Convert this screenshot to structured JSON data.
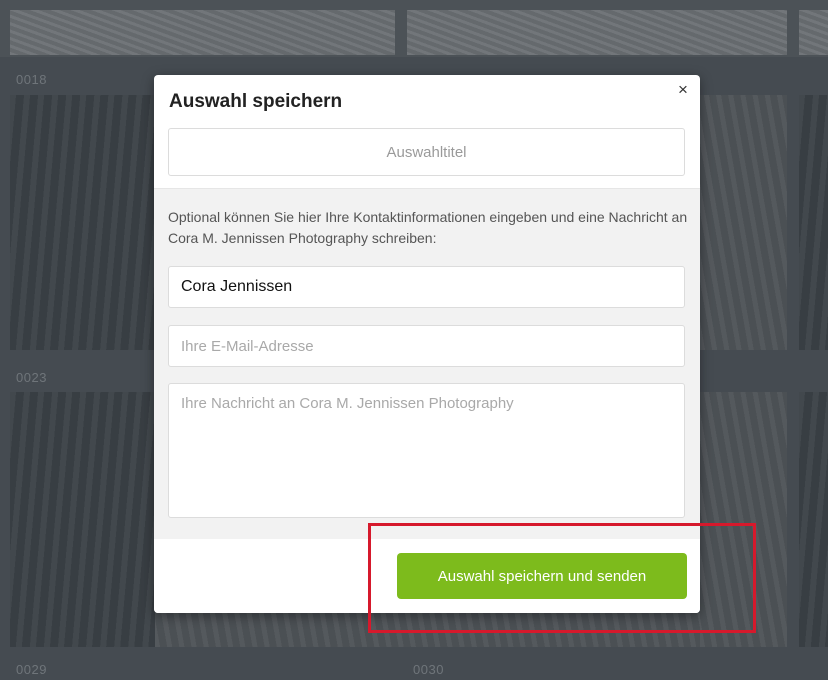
{
  "gallery": {
    "labels": [
      "0018",
      "0023",
      "0029",
      "0030"
    ]
  },
  "modal": {
    "title": "Auswahl speichern",
    "close_icon": "×",
    "title_field": {
      "placeholder": "Auswahltitel",
      "value": ""
    },
    "info_text": "Optional können Sie hier Ihre Kontaktinformationen eingeben und eine Nachricht an Cora M. Jennissen Photography schreiben:",
    "name_field": {
      "value": "Cora Jennissen"
    },
    "email_field": {
      "placeholder": "Ihre E-Mail-Adresse",
      "value": ""
    },
    "message_field": {
      "placeholder": "Ihre Nachricht an Cora M. Jennissen Photography",
      "value": ""
    },
    "submit_label": "Auswahl speichern und senden"
  },
  "colors": {
    "accent": "#7dbb1c",
    "highlight": "#d6192c",
    "overlay": "#454b51"
  }
}
